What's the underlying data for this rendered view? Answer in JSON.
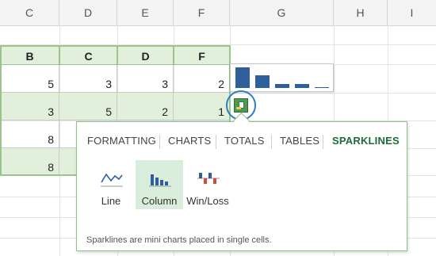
{
  "column_headers": [
    "C",
    "D",
    "E",
    "F",
    "G",
    "H",
    "I"
  ],
  "table": {
    "headers": [
      "B",
      "C",
      "D",
      "F"
    ],
    "rows": [
      [
        "5",
        "3",
        "3",
        "2"
      ],
      [
        "3",
        "5",
        "2",
        "1"
      ],
      [
        "8",
        "",
        "",
        ""
      ],
      [
        "8",
        "",
        "",
        ""
      ]
    ]
  },
  "sparkline_preview": {
    "values": [
      5,
      3,
      1,
      1,
      0.2
    ],
    "color": "#2e5f9a"
  },
  "quick_analysis": {
    "icon": "quick-analysis-icon"
  },
  "popup": {
    "tabs": [
      "FORMATTING",
      "CHARTS",
      "TOTALS",
      "TABLES",
      "SPARKLINES"
    ],
    "active_tab": "SPARKLINES",
    "options": [
      {
        "label": "Line",
        "icon": "sparkline-line-icon"
      },
      {
        "label": "Column",
        "icon": "sparkline-column-icon"
      },
      {
        "label": "Win/Loss",
        "icon": "sparkline-winloss-icon"
      }
    ],
    "selected_option": "Column",
    "footer": "Sparklines are mini charts placed in single cells."
  },
  "colors": {
    "accent": "#1f6b37",
    "table_fill": "#e2efda",
    "sparkline_blue": "#2e5f9a",
    "focus_ring": "#2e7cc6"
  }
}
